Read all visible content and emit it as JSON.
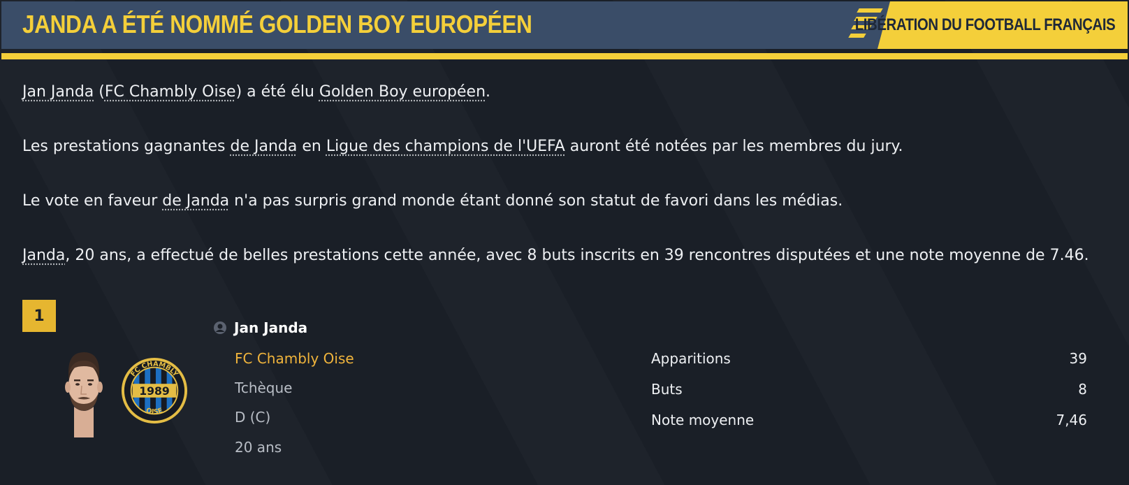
{
  "header": {
    "title": "JANDA A ÉTÉ NOMMÉ GOLDEN BOY EUROPÉEN",
    "source": "LIBÉRATION DU FOOTBALL FRANÇAIS"
  },
  "article": {
    "p1": {
      "player": "Jan Janda",
      "paren_open": " (",
      "club": "FC Chambly Oise",
      "mid": ") a été élu ",
      "award": "Golden Boy européen",
      "end": "."
    },
    "p2": {
      "start": "Les prestations gagnantes ",
      "player": "de Janda",
      "mid": " en ",
      "competition": "Ligue des champions de l'UEFA",
      "end": " auront été notées par les membres du jury."
    },
    "p3": {
      "start": "Le vote en faveur ",
      "player": "de Janda",
      "end": " n'a pas surpris grand monde étant donné son statut de favori dans les médias."
    },
    "p4": {
      "player": "Janda",
      "end": ", 20 ans, a effectué de belles prestations cette année, avec 8 buts inscrits en 39 rencontres disputées et une note moyenne de 7.46."
    }
  },
  "winner": {
    "rank": "1",
    "name": "Jan Janda",
    "club": "FC Chambly Oise",
    "nationality": "Tchèque",
    "position": "D (C)",
    "age": "20 ans",
    "club_logo_text_top": "FC CHAMBLY",
    "club_logo_year": "1989",
    "club_logo_text_bottom": "OISE"
  },
  "stats": [
    {
      "label": "Apparitions",
      "value": "39"
    },
    {
      "label": "Buts",
      "value": "8"
    },
    {
      "label": "Note moyenne",
      "value": "7,46"
    }
  ],
  "colors": {
    "accent": "#f4cf3a",
    "header_bg": "#3a4d68",
    "page_bg": "#1a1f27",
    "club_text": "#f0b43c"
  },
  "icons": {
    "player_icon": "person-icon"
  }
}
